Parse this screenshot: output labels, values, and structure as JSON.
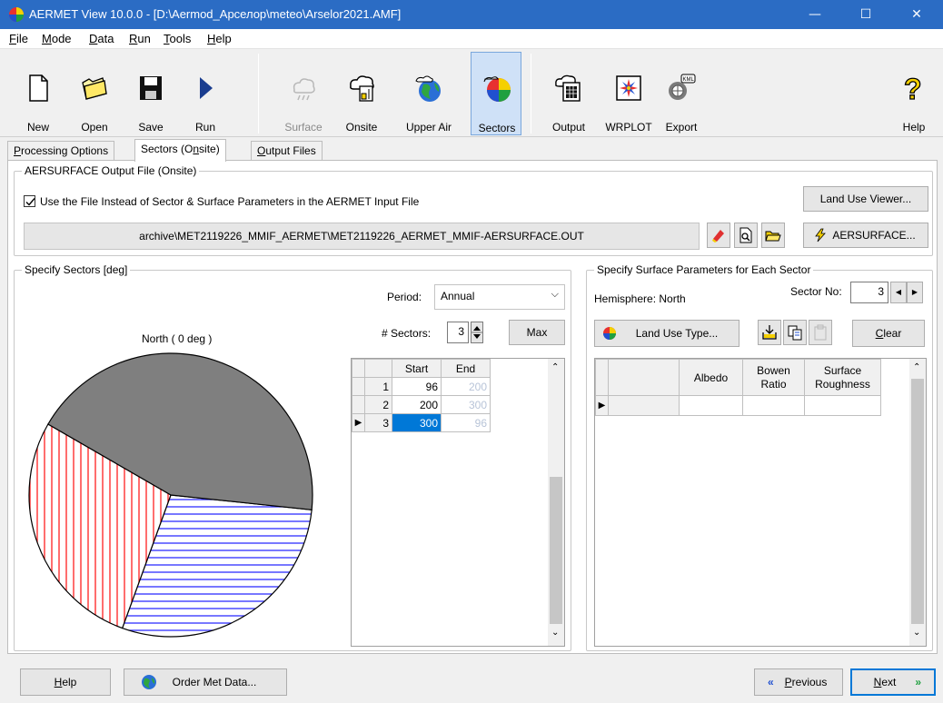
{
  "window": {
    "title": "AERMET View 10.0.0 - [D:\\Aermod_Арселор\\meteo\\Arselor2021.AMF]",
    "minimize": "—",
    "maximize": "☐",
    "close": "✕"
  },
  "menu": [
    {
      "label": "File",
      "ul": "F",
      "rest": "ile"
    },
    {
      "label": "Mode",
      "ul": "M",
      "rest": "ode"
    },
    {
      "label": "Data",
      "ul": "D",
      "rest": "ata"
    },
    {
      "label": "Run",
      "ul": "R",
      "rest": "un"
    },
    {
      "label": "Tools",
      "ul": "T",
      "rest": "ools"
    },
    {
      "label": "Help",
      "ul": "H",
      "rest": "elp"
    }
  ],
  "toolbar": {
    "new": "New",
    "open": "Open",
    "save": "Save",
    "run": "Run",
    "surface": "Surface",
    "onsite": "Onsite",
    "upper_air": "Upper Air",
    "sectors": "Sectors",
    "output": "Output",
    "wrplot": "WRPLOT",
    "export": "Export",
    "help": "Help"
  },
  "tabs": {
    "processing": {
      "ul": "P",
      "rest": "rocessing Options"
    },
    "sectors": {
      "pre": "Sectors (O",
      "ul": "n",
      "post": "site)"
    },
    "output": {
      "ul": "O",
      "rest": "utput Files"
    }
  },
  "aersurface": {
    "group_title": "AERSURFACE Output File (Onsite)",
    "checkbox_label": "Use the File Instead of Sector & Surface Parameters in the AERMET Input File",
    "checked": true,
    "land_use_viewer": "Land Use Viewer...",
    "file_path": "archive\\MET2119226_MMIF_AERMET\\MET2119226_AERMET_MMIF-AERSURFACE.OUT",
    "aersurface_button": "AERSURFACE..."
  },
  "sectors": {
    "group_title": "Specify Sectors [deg]",
    "north_label": "North ( 0 deg )",
    "period_label": "Period:",
    "period_value": "Annual",
    "num_sectors_label": "# Sectors:",
    "num_sectors": "3",
    "max_button": "Max",
    "columns": [
      "Start",
      "End"
    ],
    "rows": [
      {
        "n": "1",
        "start": "96",
        "end": "200"
      },
      {
        "n": "2",
        "start": "200",
        "end": "300"
      },
      {
        "n": "3",
        "start": "300",
        "end": "96"
      }
    ]
  },
  "surface": {
    "group_title": "Specify Surface Parameters for Each Sector",
    "hemisphere": "Hemisphere: North",
    "sector_no_label": "Sector No:",
    "sector_no": "3",
    "land_use_type": "Land Use Type...",
    "clear": {
      "ul": "C",
      "rest": "lear"
    },
    "columns": [
      "Albedo",
      "Bowen Ratio",
      "Surface Roughness"
    ]
  },
  "bottom": {
    "help": {
      "ul": "H",
      "rest": "elp"
    },
    "order": "Order Met Data...",
    "previous": {
      "ul": "P",
      "rest": "revious"
    },
    "next": {
      "ul": "N",
      "rest": "ext"
    }
  },
  "chart_data": {
    "type": "pie",
    "title": "",
    "sectors": [
      {
        "start": 96,
        "end": 200,
        "pattern": "horizontal-lines",
        "color": "#3030ff"
      },
      {
        "start": 200,
        "end": 300,
        "pattern": "vertical-lines",
        "color": "#ff2020"
      },
      {
        "start": 300,
        "end": 96,
        "pattern": "solid",
        "color": "#7f7f7f"
      }
    ]
  }
}
